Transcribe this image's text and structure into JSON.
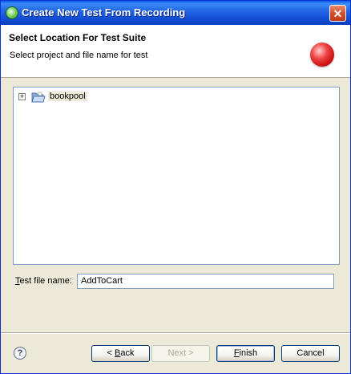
{
  "window": {
    "title": "Create New Test From Recording",
    "close_glyph": "✕"
  },
  "header": {
    "title": "Select Location For Test Suite",
    "description": "Select project and file name for test",
    "graphic_icon": "record-ball-icon",
    "graphic_color": "#d81c1c"
  },
  "tree": {
    "items": [
      {
        "label": "bookpool",
        "expander": "+",
        "icon": "open-folder-icon"
      }
    ]
  },
  "form": {
    "test_file_label_mnemonic": "T",
    "test_file_label_rest": "est file name:",
    "test_file_value": "AddToCart"
  },
  "buttons": {
    "help_glyph": "?",
    "back_prefix": "< ",
    "back_mnemonic": "B",
    "back_rest": "ack",
    "next_label": "Next >",
    "finish_mnemonic": "F",
    "finish_rest": "inish",
    "cancel_label": "Cancel"
  },
  "colors": {
    "titlebar": "#0a58e8",
    "dialog_bg": "#ece9d8",
    "input_border": "#7f9db9"
  }
}
